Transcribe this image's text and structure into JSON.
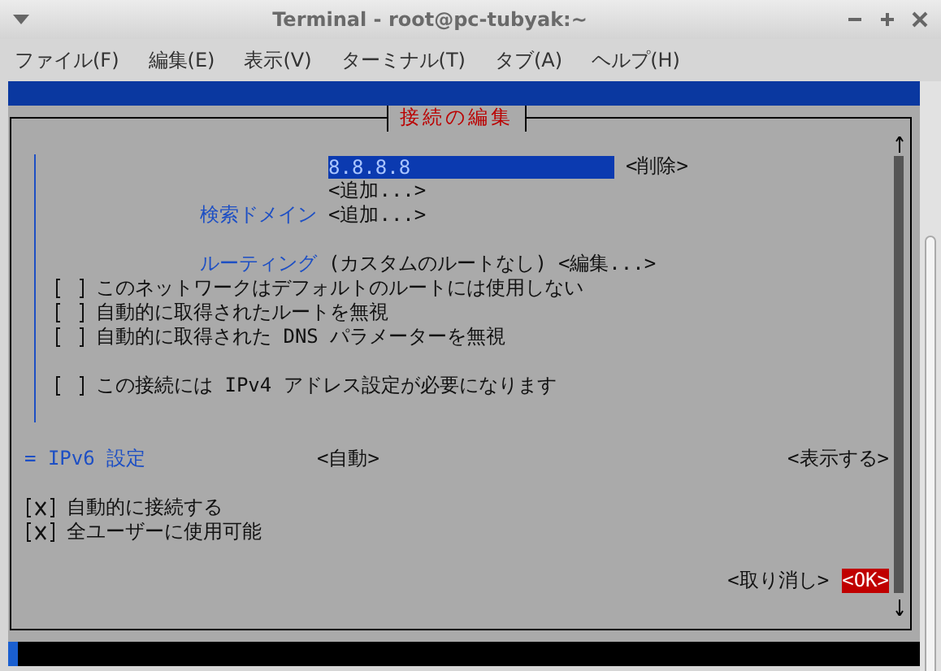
{
  "window": {
    "title": "Terminal - root@pc-tubyak:~"
  },
  "menu": [
    {
      "label": "ファイル(F)"
    },
    {
      "label": "編集(E)"
    },
    {
      "label": "表示(V)"
    },
    {
      "label": "ターミナル(T)"
    },
    {
      "label": "タブ(A)"
    },
    {
      "label": "ヘルプ(H)"
    }
  ],
  "dialog": {
    "title": "接続の編集",
    "dns": {
      "value": "8.8.8.8",
      "remove": "<削除>",
      "add": "<追加...>"
    },
    "search_domains": {
      "label": "検索ドメイン",
      "add": "<追加...>"
    },
    "routing": {
      "label": "ルーティング",
      "value": "(カスタムのルートなし)",
      "edit": "<編集...>"
    },
    "ipv4_options": [
      {
        "label": "このネットワークはデフォルトのルートには使用しない",
        "checked": false
      },
      {
        "label": "自動的に取得されたルートを無視",
        "checked": false
      },
      {
        "label": "自動的に取得された DNS パラメーターを無視",
        "checked": false
      }
    ],
    "ipv4_required": {
      "label": "この接続には IPv4 アドレス設定が必要になります",
      "checked": false
    },
    "ipv6": {
      "label": "= IPv6 設定",
      "mode": "<自動>",
      "show": "<表示する>"
    },
    "options": [
      {
        "label": "自動的に接続する",
        "checked": true
      },
      {
        "label": "全ユーザーに使用可能",
        "checked": true
      }
    ],
    "buttons": [
      {
        "label": "<取り消し>",
        "selected": false
      },
      {
        "label": "<OK>",
        "selected": true
      }
    ]
  }
}
